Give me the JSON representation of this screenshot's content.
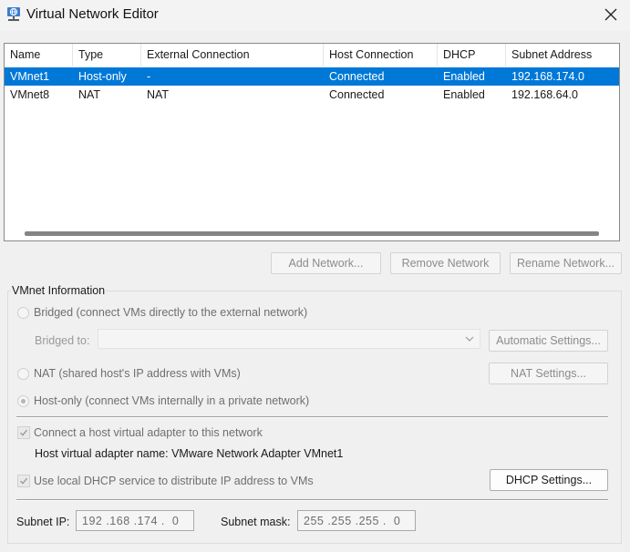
{
  "window": {
    "title": "Virtual Network Editor",
    "icon": "network-globe-icon",
    "close_icon": "close-icon"
  },
  "table": {
    "columns": [
      "Name",
      "Type",
      "External Connection",
      "Host Connection",
      "DHCP",
      "Subnet Address"
    ],
    "rows": [
      {
        "name": "VMnet1",
        "type": "Host-only",
        "external": "-",
        "host": "Connected",
        "dhcp": "Enabled",
        "subnet": "192.168.174.0",
        "selected": true
      },
      {
        "name": "VMnet8",
        "type": "NAT",
        "external": "NAT",
        "host": "Connected",
        "dhcp": "Enabled",
        "subnet": "192.168.64.0",
        "selected": false
      }
    ]
  },
  "buttons": {
    "add_network": "Add Network...",
    "remove_network": "Remove Network",
    "rename_network": "Rename Network..."
  },
  "vmnet_info": {
    "title": "VMnet Information",
    "bridged_label": "Bridged (connect VMs directly to the external network)",
    "bridged_to_label": "Bridged to:",
    "bridged_to_value": "",
    "automatic_settings": "Automatic Settings...",
    "nat_label": "NAT (shared host's IP address with VMs)",
    "nat_settings": "NAT Settings...",
    "hostonly_label": "Host-only (connect VMs internally in a private network)",
    "selected_mode": "host-only",
    "connect_adapter_label": "Connect a host virtual adapter to this network",
    "connect_adapter_checked": true,
    "adapter_name_label": "Host virtual adapter name: VMware Network Adapter VMnet1",
    "dhcp_label": "Use local DHCP service to distribute IP address to VMs",
    "dhcp_checked": true,
    "dhcp_settings": "DHCP Settings...",
    "subnet_ip_label": "Subnet IP:",
    "subnet_ip_value": "192 .168 .174 .  0",
    "subnet_mask_label": "Subnet mask:",
    "subnet_mask_value": "255 .255 .255 .  0"
  },
  "colors": {
    "selection": "#0078d7",
    "background": "#f0f0f0"
  }
}
